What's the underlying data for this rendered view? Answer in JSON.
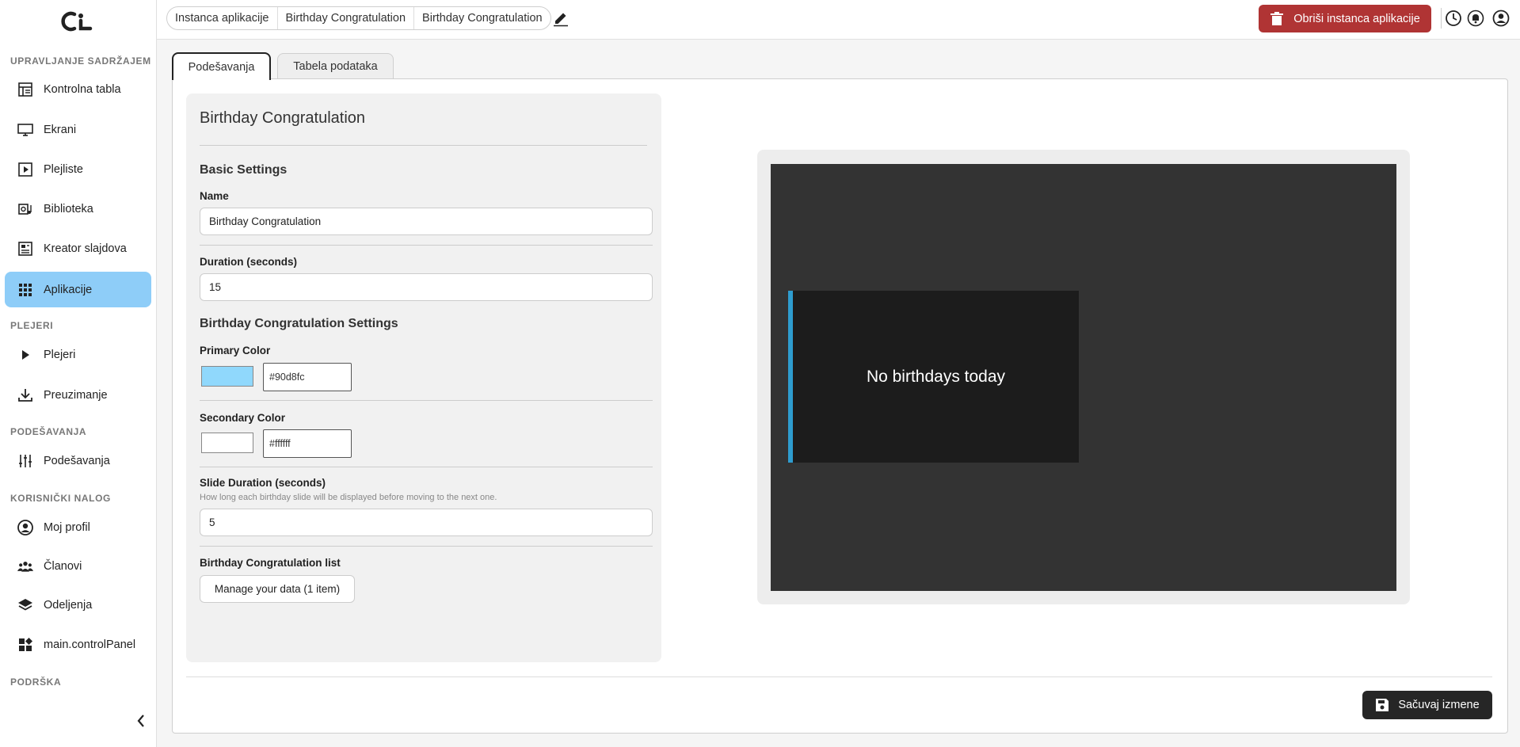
{
  "sidebar": {
    "logo": "ci-logo",
    "sections": [
      {
        "title": "UPRAVLJANJE SADRŽAJEM"
      },
      {
        "title": "PLEJERI"
      },
      {
        "title": "PODEŠAVANJA"
      },
      {
        "title": "KORISNIČKI NALOG"
      },
      {
        "title": "PODRŠKA"
      }
    ],
    "items": [
      {
        "label": "Kontrolna tabla",
        "icon": "dashboard-icon"
      },
      {
        "label": "Ekrani",
        "icon": "monitor-icon"
      },
      {
        "label": "Plejliste",
        "icon": "playlist-icon"
      },
      {
        "label": "Biblioteka",
        "icon": "library-icon"
      },
      {
        "label": "Kreator slajdova",
        "icon": "slide-creator-icon"
      },
      {
        "label": "Aplikacije",
        "icon": "apps-grid-icon",
        "active": true
      },
      {
        "label": "Plejeri",
        "icon": "play-icon"
      },
      {
        "label": "Preuzimanje",
        "icon": "download-icon"
      },
      {
        "label": "Podešavanja",
        "icon": "sliders-icon"
      },
      {
        "label": "Moj profil",
        "icon": "user-circle-icon"
      },
      {
        "label": "Članovi",
        "icon": "members-icon"
      },
      {
        "label": "Odeljenja",
        "icon": "layers-icon"
      },
      {
        "label": "main.controlPanel",
        "icon": "widgets-icon"
      }
    ]
  },
  "header": {
    "breadcrumb": [
      "Instanca aplikacije",
      "Birthday Congratulation",
      "Birthday Congratulation"
    ],
    "delete_label": "Obriši instanca aplikacije",
    "icons": [
      "history-icon",
      "bell-icon",
      "account-icon"
    ]
  },
  "tabs": [
    {
      "label": "Podešavanja",
      "active": true
    },
    {
      "label": "Tabela podataka",
      "active": false
    }
  ],
  "form": {
    "title": "Birthday Congratulation",
    "basic_heading": "Basic Settings",
    "name_label": "Name",
    "name_value": "Birthday Congratulation",
    "duration_label": "Duration (seconds)",
    "duration_value": "15",
    "bc_heading": "Birthday Congratulation Settings",
    "primary_label": "Primary Color",
    "primary_value": "#90d8fc",
    "secondary_label": "Secondary Color",
    "secondary_value": "#ffffff",
    "slide_label": "Slide Duration (seconds)",
    "slide_hint": "How long each birthday slide will be displayed before moving to the next one.",
    "slide_value": "5",
    "list_label": "Birthday Congratulation list",
    "manage_label": "Manage your data (1 item)"
  },
  "preview": {
    "message": "No birthdays today",
    "accent": "#2e9ccf"
  },
  "save_label": "Sačuvaj izmene",
  "colors": {
    "active_nav": "#8ecdf8",
    "danger": "#b03434",
    "dark_button": "#262626"
  }
}
